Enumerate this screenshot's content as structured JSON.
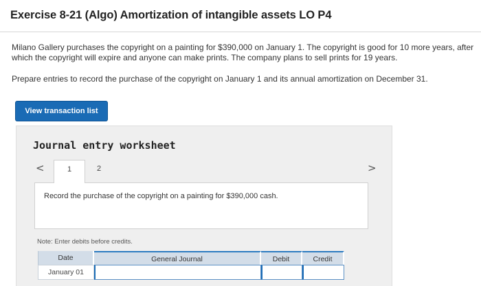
{
  "exercise": {
    "title": "Exercise 8-21 (Algo) Amortization of intangible assets LO P4",
    "problem": "Milano Gallery purchases the copyright on a painting for $390,000 on January 1. The copyright is good for 10 more years, after which the copyright will expire and anyone can make prints. The company plans to sell prints for 19 years.",
    "instruction": "Prepare entries to record the purchase of the copyright on January 1 and its annual amortization on December 31."
  },
  "actions": {
    "view_transactions_label": "View transaction list"
  },
  "worksheet": {
    "title": "Journal entry worksheet",
    "prev_glyph": "<",
    "next_glyph": ">",
    "tabs": [
      {
        "label": "1",
        "active": true
      },
      {
        "label": "2",
        "active": false
      }
    ],
    "entry_prompt": "Record the purchase of the copyright on a painting for $390,000 cash.",
    "note": "Note: Enter debits before credits.",
    "table": {
      "headers": [
        "Date",
        "General Journal",
        "Debit",
        "Credit"
      ],
      "rows": [
        {
          "date": "January 01",
          "account": "",
          "debit": "",
          "credit": ""
        }
      ]
    }
  },
  "colors": {
    "button_bg": "#1a6bb5",
    "table_header_bg": "#d3dde8",
    "panel_bg": "#efefef"
  }
}
